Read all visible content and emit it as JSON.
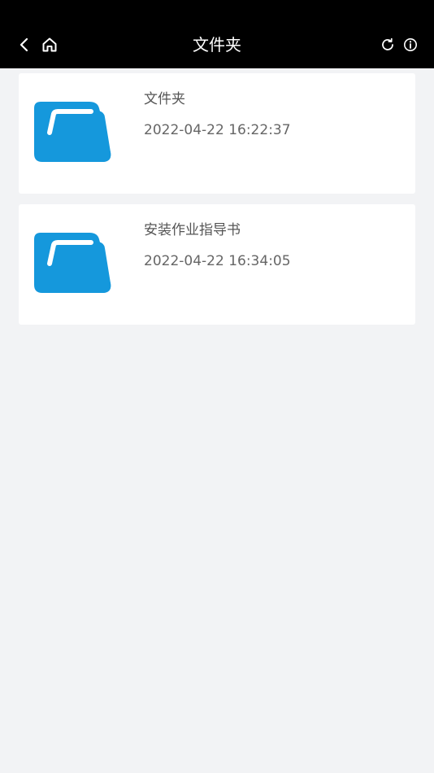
{
  "header": {
    "title": "文件夹",
    "icons": {
      "back": "chevron-left-icon",
      "home": "home-icon",
      "refresh": "refresh-icon",
      "info": "info-icon"
    }
  },
  "items": [
    {
      "name": "文件夹",
      "date": "2022-04-22 16:22:37",
      "icon": "folder-icon"
    },
    {
      "name": "安装作业指导书",
      "date": "2022-04-22 16:34:05",
      "icon": "folder-icon"
    }
  ],
  "colors": {
    "header_bg": "#000000",
    "page_bg": "#f2f3f5",
    "folder": "#1598dc",
    "text": "#555555"
  }
}
